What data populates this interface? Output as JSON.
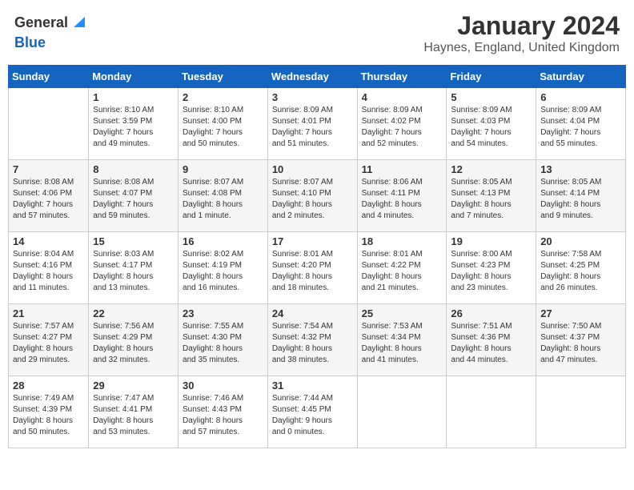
{
  "header": {
    "logo_general": "General",
    "logo_blue": "Blue",
    "month_year": "January 2024",
    "location": "Haynes, England, United Kingdom"
  },
  "days_of_week": [
    "Sunday",
    "Monday",
    "Tuesday",
    "Wednesday",
    "Thursday",
    "Friday",
    "Saturday"
  ],
  "weeks": [
    [
      {
        "day": "",
        "info": ""
      },
      {
        "day": "1",
        "info": "Sunrise: 8:10 AM\nSunset: 3:59 PM\nDaylight: 7 hours\nand 49 minutes."
      },
      {
        "day": "2",
        "info": "Sunrise: 8:10 AM\nSunset: 4:00 PM\nDaylight: 7 hours\nand 50 minutes."
      },
      {
        "day": "3",
        "info": "Sunrise: 8:09 AM\nSunset: 4:01 PM\nDaylight: 7 hours\nand 51 minutes."
      },
      {
        "day": "4",
        "info": "Sunrise: 8:09 AM\nSunset: 4:02 PM\nDaylight: 7 hours\nand 52 minutes."
      },
      {
        "day": "5",
        "info": "Sunrise: 8:09 AM\nSunset: 4:03 PM\nDaylight: 7 hours\nand 54 minutes."
      },
      {
        "day": "6",
        "info": "Sunrise: 8:09 AM\nSunset: 4:04 PM\nDaylight: 7 hours\nand 55 minutes."
      }
    ],
    [
      {
        "day": "7",
        "info": "Sunrise: 8:08 AM\nSunset: 4:06 PM\nDaylight: 7 hours\nand 57 minutes."
      },
      {
        "day": "8",
        "info": "Sunrise: 8:08 AM\nSunset: 4:07 PM\nDaylight: 7 hours\nand 59 minutes."
      },
      {
        "day": "9",
        "info": "Sunrise: 8:07 AM\nSunset: 4:08 PM\nDaylight: 8 hours\nand 1 minute."
      },
      {
        "day": "10",
        "info": "Sunrise: 8:07 AM\nSunset: 4:10 PM\nDaylight: 8 hours\nand 2 minutes."
      },
      {
        "day": "11",
        "info": "Sunrise: 8:06 AM\nSunset: 4:11 PM\nDaylight: 8 hours\nand 4 minutes."
      },
      {
        "day": "12",
        "info": "Sunrise: 8:05 AM\nSunset: 4:13 PM\nDaylight: 8 hours\nand 7 minutes."
      },
      {
        "day": "13",
        "info": "Sunrise: 8:05 AM\nSunset: 4:14 PM\nDaylight: 8 hours\nand 9 minutes."
      }
    ],
    [
      {
        "day": "14",
        "info": "Sunrise: 8:04 AM\nSunset: 4:16 PM\nDaylight: 8 hours\nand 11 minutes."
      },
      {
        "day": "15",
        "info": "Sunrise: 8:03 AM\nSunset: 4:17 PM\nDaylight: 8 hours\nand 13 minutes."
      },
      {
        "day": "16",
        "info": "Sunrise: 8:02 AM\nSunset: 4:19 PM\nDaylight: 8 hours\nand 16 minutes."
      },
      {
        "day": "17",
        "info": "Sunrise: 8:01 AM\nSunset: 4:20 PM\nDaylight: 8 hours\nand 18 minutes."
      },
      {
        "day": "18",
        "info": "Sunrise: 8:01 AM\nSunset: 4:22 PM\nDaylight: 8 hours\nand 21 minutes."
      },
      {
        "day": "19",
        "info": "Sunrise: 8:00 AM\nSunset: 4:23 PM\nDaylight: 8 hours\nand 23 minutes."
      },
      {
        "day": "20",
        "info": "Sunrise: 7:58 AM\nSunset: 4:25 PM\nDaylight: 8 hours\nand 26 minutes."
      }
    ],
    [
      {
        "day": "21",
        "info": "Sunrise: 7:57 AM\nSunset: 4:27 PM\nDaylight: 8 hours\nand 29 minutes."
      },
      {
        "day": "22",
        "info": "Sunrise: 7:56 AM\nSunset: 4:29 PM\nDaylight: 8 hours\nand 32 minutes."
      },
      {
        "day": "23",
        "info": "Sunrise: 7:55 AM\nSunset: 4:30 PM\nDaylight: 8 hours\nand 35 minutes."
      },
      {
        "day": "24",
        "info": "Sunrise: 7:54 AM\nSunset: 4:32 PM\nDaylight: 8 hours\nand 38 minutes."
      },
      {
        "day": "25",
        "info": "Sunrise: 7:53 AM\nSunset: 4:34 PM\nDaylight: 8 hours\nand 41 minutes."
      },
      {
        "day": "26",
        "info": "Sunrise: 7:51 AM\nSunset: 4:36 PM\nDaylight: 8 hours\nand 44 minutes."
      },
      {
        "day": "27",
        "info": "Sunrise: 7:50 AM\nSunset: 4:37 PM\nDaylight: 8 hours\nand 47 minutes."
      }
    ],
    [
      {
        "day": "28",
        "info": "Sunrise: 7:49 AM\nSunset: 4:39 PM\nDaylight: 8 hours\nand 50 minutes."
      },
      {
        "day": "29",
        "info": "Sunrise: 7:47 AM\nSunset: 4:41 PM\nDaylight: 8 hours\nand 53 minutes."
      },
      {
        "day": "30",
        "info": "Sunrise: 7:46 AM\nSunset: 4:43 PM\nDaylight: 8 hours\nand 57 minutes."
      },
      {
        "day": "31",
        "info": "Sunrise: 7:44 AM\nSunset: 4:45 PM\nDaylight: 9 hours\nand 0 minutes."
      },
      {
        "day": "",
        "info": ""
      },
      {
        "day": "",
        "info": ""
      },
      {
        "day": "",
        "info": ""
      }
    ]
  ]
}
